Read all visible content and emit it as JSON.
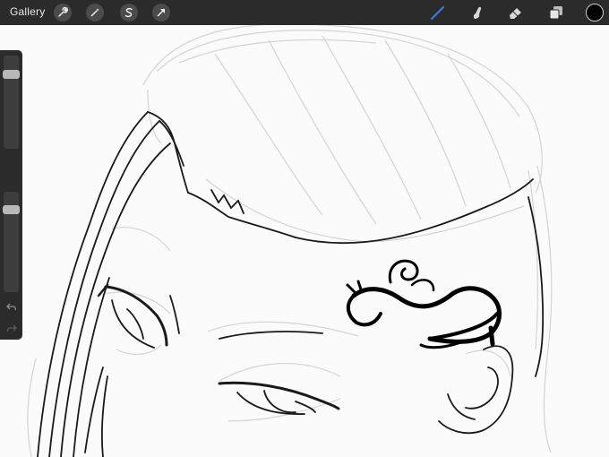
{
  "toolbar": {
    "gallery_label": "Gallery",
    "left_tools": [
      {
        "name": "actions-wrench-icon"
      },
      {
        "name": "adjustments-wand-icon"
      },
      {
        "name": "selection-s-icon"
      },
      {
        "name": "transform-arrow-icon"
      }
    ],
    "right_tools": [
      {
        "name": "brush-icon",
        "active": true
      },
      {
        "name": "smudge-icon",
        "active": false
      },
      {
        "name": "eraser-icon",
        "active": false
      },
      {
        "name": "layers-icon",
        "active": false
      }
    ],
    "current_color": "#000000"
  },
  "sidebar": {
    "brush_size_level": 0.17,
    "brush_opacity_level": 0.85,
    "buttons": [
      "modify-square",
      "undo-arrow",
      "redo-arrow"
    ]
  },
  "colors": {
    "chrome": "#2b2b2b",
    "accent": "#2f7ef6",
    "canvas": "#fbfbfb",
    "sketch": "#cfcfcf",
    "ink": "#000000"
  }
}
